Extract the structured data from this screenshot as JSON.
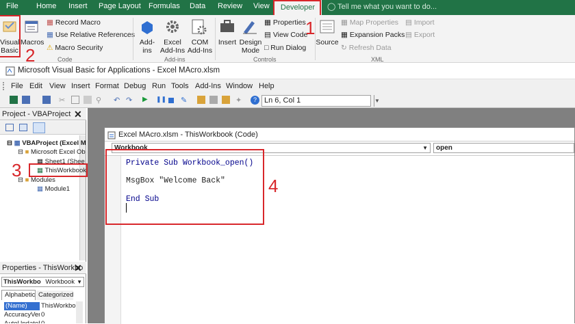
{
  "ribbon": {
    "tabs": [
      "File",
      "Home",
      "Insert",
      "Page Layout",
      "Formulas",
      "Data",
      "Review",
      "View",
      "Developer"
    ],
    "tell_me": "Tell me what you want to do...",
    "code_group": {
      "visual_basic": [
        "Visual",
        "Basic"
      ],
      "macros": "Macros",
      "record_macro": "Record Macro",
      "relative_refs": "Use Relative References",
      "macro_security": "Macro Security",
      "label": "Code"
    },
    "addins_group": {
      "addins": [
        "Add-",
        "ins"
      ],
      "excel_addins": [
        "Excel",
        "Add-Ins"
      ],
      "com_addins": [
        "COM",
        "Add-Ins"
      ],
      "label": "Add-ins"
    },
    "controls_group": {
      "insert": "Insert",
      "design_mode": [
        "Design",
        "Mode"
      ],
      "properties": "Properties",
      "view_code": "View Code",
      "run_dialog": "Run Dialog",
      "label": "Controls"
    },
    "xml_group": {
      "source": "Source",
      "map_properties": "Map Properties",
      "expansion_packs": "Expansion Packs",
      "refresh_data": "Refresh Data",
      "import": "Import",
      "export": "Export",
      "label": "XML"
    }
  },
  "annotations": [
    "1",
    "2",
    "3",
    "4"
  ],
  "vba": {
    "title": "Microsoft Visual Basic for Applications - Excel MAcro.xlsm",
    "menus": [
      "File",
      "Edit",
      "View",
      "Insert",
      "Format",
      "Debug",
      "Run",
      "Tools",
      "Add-Ins",
      "Window",
      "Help"
    ],
    "position": "Ln 6, Col 1",
    "project_title": "Project - VBAProject",
    "tree": {
      "root": "VBAProject (Excel M",
      "folder1": "Microsoft Excel Ob",
      "sheet1": "Sheet1 (Shee",
      "thisworkbook": "ThisWorkbook",
      "modules": "Modules",
      "module1": "Module1"
    },
    "properties": {
      "title": "Properties - ThisWorkbo",
      "object": "ThisWorkbo",
      "object_type": "Workbook",
      "tabs": [
        "Alphabetic",
        "Categorized"
      ],
      "rows": [
        [
          "(Name)",
          "ThisWorkbo"
        ],
        [
          "AccuracyVers",
          "0"
        ],
        [
          "AutoUpdateF",
          "0"
        ]
      ]
    },
    "code_window": {
      "title": "Excel MAcro.xlsm - ThisWorkbook (Code)",
      "object_combo": "Workbook",
      "proc_combo": "open",
      "lines": [
        "Private Sub Workbook_open()",
        "MsgBox \"Welcome Back\"",
        "End Sub"
      ]
    }
  },
  "colors": {
    "excel_green": "#217346",
    "annotation_red": "#d8262a",
    "vba_keyword": "#00008b"
  }
}
